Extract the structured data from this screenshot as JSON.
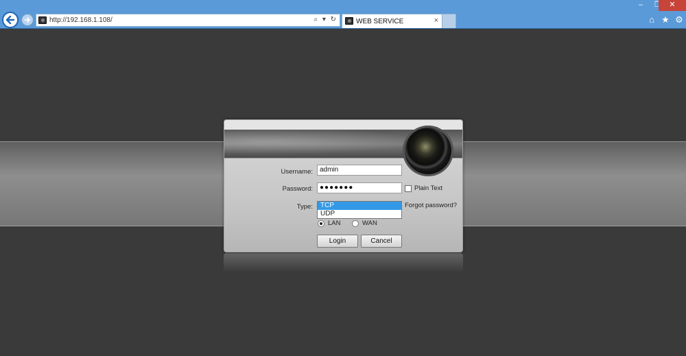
{
  "window": {
    "minimize_glyph": "–",
    "restore_glyph": "❐",
    "close_glyph": "✕"
  },
  "browser": {
    "address": "http://192.168.1.108/",
    "address_tools": "⌕ ▾ ↻",
    "tab_title": "WEB SERVICE",
    "tab_close": "×",
    "icons": [
      "back-icon",
      "forward-icon",
      "home-icon",
      "favorites-star-icon",
      "settings-gear-icon"
    ]
  },
  "login": {
    "username_label": "Username:",
    "username_value": "admin",
    "password_label": "Password:",
    "password_value": "●●●●●●●",
    "plain_text_label": "Plain Text",
    "type_label": "Type:",
    "type_options": [
      "TCP",
      "UDP"
    ],
    "type_selected": "TCP",
    "forgot_password": "Forgot password?",
    "network_lan": "LAN",
    "network_wan": "WAN",
    "network_selected": "LAN",
    "login_button": "Login",
    "cancel_button": "Cancel"
  },
  "colors": {
    "chrome_blue": "#5a9ad8",
    "selection_blue": "#3399e6",
    "page_background": "#3a3a3a"
  }
}
